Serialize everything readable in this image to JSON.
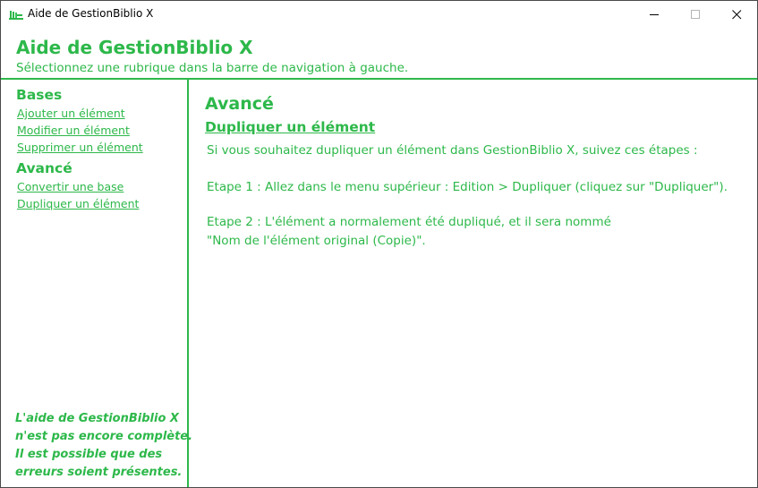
{
  "window": {
    "title": "Aide de GestionBiblio X",
    "icon": "bookshelf-icon"
  },
  "header": {
    "title": "Aide de GestionBiblio X",
    "subtitle": "Sélectionnez une rubrique dans la barre de navigation à gauche."
  },
  "sidebar": {
    "sections": [
      {
        "label": "Bases",
        "links": [
          "Ajouter un élément",
          "Modifier un élément",
          "Supprimer un élément"
        ]
      },
      {
        "label": "Avancé",
        "links": [
          "Convertir une base",
          "Dupliquer un élément"
        ]
      }
    ],
    "note": [
      "L'aide de GestionBiblio X",
      "n'est pas encore complète.",
      "Il est possible que des",
      "erreurs soient présentes."
    ]
  },
  "content": {
    "section": "Avancé",
    "heading": "Dupliquer un élément",
    "intro": "Si vous souhaitez dupliquer un élément dans GestionBiblio X, suivez ces étapes :",
    "step1": "Etape 1 : Allez dans le menu supérieur : Edition > Dupliquer (cliquez sur \"Dupliquer\").",
    "step2_line1": "Etape 2 : L'élément a normalement été dupliqué, et il sera nommé",
    "step2_line2": "\"Nom de l'élément original (Copie)\"."
  },
  "colors": {
    "accent": "#2db84a",
    "border": "#4a4a4a",
    "background": "#ffffff"
  }
}
